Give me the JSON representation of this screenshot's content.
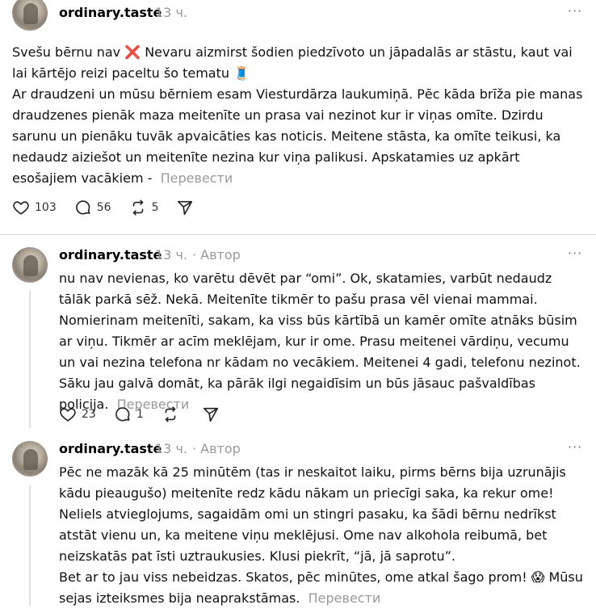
{
  "posts": [
    {
      "username": "ordinary.taste",
      "time": "13 ч.",
      "author_label": "",
      "more": "···",
      "paragraphs": [
        "Svešu bērnu nav ❌ Nevaru aizmirst šodien piedzīvoto un jāpadalās ar stāstu, kaut vai lai kārtējo reizi paceltu šo tematu 🧵",
        "Ar draudzeni un mūsu bērniem esam Viesturdārza laukumiņā. Pēc kāda brīža pie manas draudzenes pienāk maza meitenīte un prasa vai nezinot kur ir viņas omīte. Dzirdu sarunu un pienāku tuvāk apvaicāties kas noticis. Meitene stāsta, ka omīte teikusi, ka nedaudz aiziešot un meitenīte nezina kur viņa palikusi. Apskatamies uz apkārt esošajiem vacākiem -"
      ],
      "translate": "Перевести",
      "likes": "103",
      "comments": "56",
      "reposts": "5"
    },
    {
      "username": "ordinary.taste",
      "time": "13 ч.",
      "author_label": "· Автор",
      "more": "···",
      "paragraphs": [
        "nu nav nevienas, ko varētu dēvēt par “omi”. Ok, skatamies, varbūt nedaudz tālāk parkā sēž. Nekā. Meitenīte tikmēr to pašu prasa vēl vienai mammai. Nomierinam meitenīti, sakam, ka viss būs kārtībā un kamēr omīte atnāks būsim ar viņu. Tikmēr ar acīm meklējam, kur ir ome. Prasu meitenei vārdiņu, vecumu un vai nezina telefona nr kādam no vecākiem. Meitenei 4 gadi, telefonu nezinot. Sāku jau galvā domāt, ka pārāk ilgi negaidīsim un būs jāsauc pašvaldības policija."
      ],
      "translate": "Перевести",
      "likes": "23",
      "comments": "1",
      "reposts": ""
    },
    {
      "username": "ordinary.taste",
      "time": "13 ч.",
      "author_label": "· Автор",
      "more": "···",
      "paragraphs": [
        "Pēc ne mazāk kā 25 minūtēm (tas ir neskaitot laiku, pirms bērns bija uzrunājis kādu pieaugušo) meitenīte redz kādu nākam un priecīgi saka, ka rekur ome! Neliels atvieglojums, sagaidām omi un stingri pasaku, ka šādi bērnu nedrīkst atstāt vienu un, ka meitene viņu meklējusi. Ome nav alkohola reibumā, bet neizskatās pat īsti uztraukusies. Klusi piekrīt, “jā, jā saprotu”.",
        "Bet ar to jau viss nebeidzas. Skatos, pēc minūtes, ome atkal šago prom! 😱 Mūsu sejas izteiksmes bija neaprakstāmas."
      ],
      "translate": "Перевести"
    }
  ]
}
